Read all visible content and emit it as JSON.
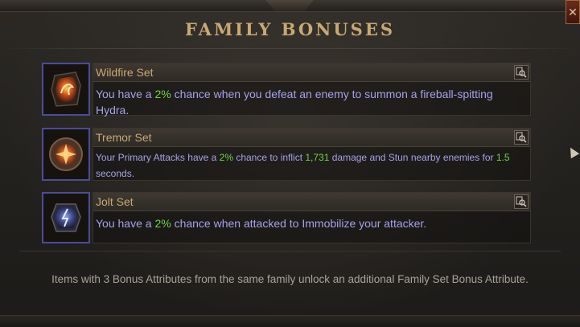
{
  "panel": {
    "title": "FAMILY BONUSES",
    "close_icon": "close-icon"
  },
  "sets": [
    {
      "name": "Wildfire Set",
      "icon": "wildfire-hydra-icon",
      "desc_before": "You have a ",
      "chance": "2%",
      "desc_after": " chance when you defeat an enemy to summon a fireball-spitting Hydra."
    },
    {
      "name": "Tremor Set",
      "icon": "tremor-stone-icon",
      "desc_before": "Your Primary Attacks have a ",
      "chance": "2%",
      "desc_mid": " chance to inflict ",
      "damage": "1,731",
      "desc_mid2": " damage and Stun nearby enemies for ",
      "duration": "1.5",
      "desc_after": " seconds."
    },
    {
      "name": "Jolt Set",
      "icon": "jolt-rune-icon",
      "desc_before": "You have a ",
      "chance": "2%",
      "desc_after": " chance when attacked to Immobilize your attacker."
    }
  ],
  "footer": {
    "text": "Items with 3 Bonus Attributes from the same family unlock an additional Family Set Bonus Attribute."
  },
  "colors": {
    "title": "#c9a874",
    "description": "#a3a3ea",
    "highlight": "#6fd24a",
    "icon_border": "#4b4c9a"
  }
}
